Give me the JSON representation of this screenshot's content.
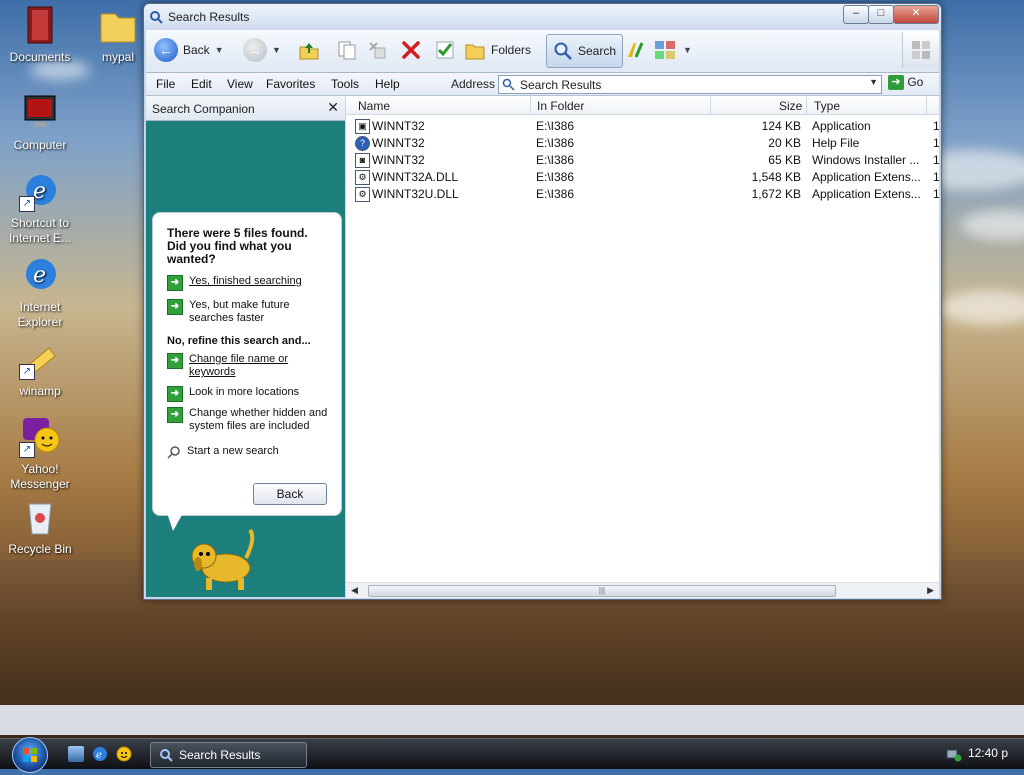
{
  "desktop": {
    "icons": [
      {
        "label": "Documents"
      },
      {
        "label": "mypal"
      },
      {
        "label": "Computer"
      },
      {
        "label": "Shortcut to Internet E..."
      },
      {
        "label": "Internet Explorer"
      },
      {
        "label": "winamp"
      },
      {
        "label": "Yahoo! Messenger"
      },
      {
        "label": "Recycle Bin"
      }
    ]
  },
  "window": {
    "title": "Search Results",
    "toolbar": {
      "back_label": "Back",
      "folders_label": "Folders",
      "search_label": "Search"
    },
    "menu": [
      "File",
      "Edit",
      "View",
      "Favorites",
      "Tools",
      "Help"
    ],
    "address": {
      "label": "Address",
      "value": "Search Results",
      "go_label": "Go"
    },
    "companion": {
      "title": "Search Companion",
      "found_text": "There were 5 files found. Did you find what you wanted?",
      "yes_finished": "Yes, finished searching",
      "yes_faster": "Yes, but make future searches faster",
      "refine_heading": "No, refine this search and...",
      "change_name": "Change file name or keywords",
      "more_locations": "Look in more locations",
      "hidden_files": "Change whether hidden and system files are included",
      "new_search": "Start a new search",
      "back_button": "Back"
    },
    "results": {
      "columns": [
        "Name",
        "In Folder",
        "Size",
        "Type"
      ],
      "rows": [
        {
          "name": "WINNT32",
          "folder": "E:\\I386",
          "size": "124 KB",
          "type": "Application"
        },
        {
          "name": "WINNT32",
          "folder": "E:\\I386",
          "size": "20 KB",
          "type": "Help File"
        },
        {
          "name": "WINNT32",
          "folder": "E:\\I386",
          "size": "65 KB",
          "type": "Windows Installer ..."
        },
        {
          "name": "WINNT32A.DLL",
          "folder": "E:\\I386",
          "size": "1,548 KB",
          "type": "Application Extens..."
        },
        {
          "name": "WINNT32U.DLL",
          "folder": "E:\\I386",
          "size": "1,672 KB",
          "type": "Application Extens..."
        }
      ]
    }
  },
  "taskbar": {
    "task_label": "Search Results",
    "clock": "12:40 p"
  },
  "colors": {
    "companion_bg": "#1d7f7c",
    "go_green": "#31a13b",
    "taskbar": "#0e1014"
  }
}
